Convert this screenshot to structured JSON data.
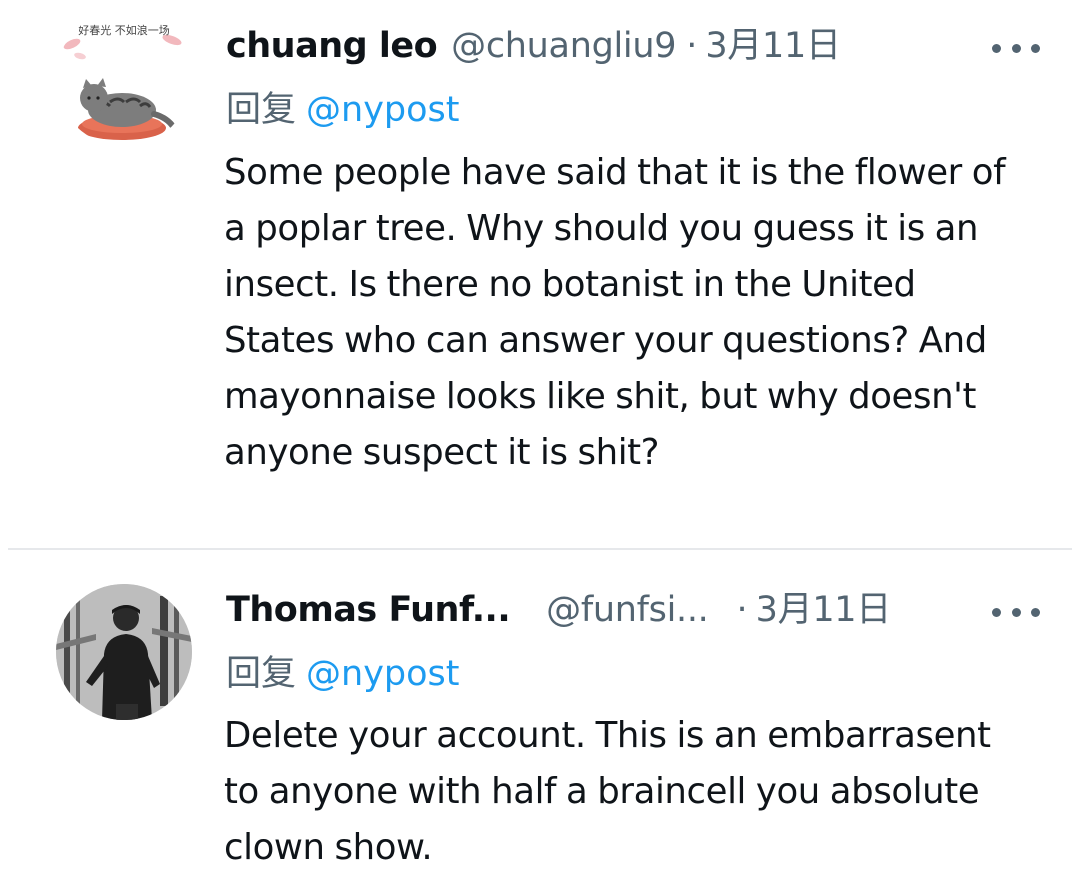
{
  "tweets": [
    {
      "display_name": "chuang leo",
      "handle": "@chuangliu9",
      "separator": "·",
      "date": "3月11日",
      "reply_prefix": "回复",
      "reply_to": "@nypost",
      "avatar_text": "好春光 不如浪一场",
      "text": "Some people have said that it is the flower of a poplar tree. Why should you guess it is an insect. Is there no botanist in the United States who can answer your questions? And mayonnaise looks like shit, but why doesn't anyone suspect it is shit?"
    },
    {
      "display_name": "Thomas Funf...",
      "handle": "@funfsi...",
      "separator": "·",
      "date": "3月11日",
      "reply_prefix": "回复",
      "reply_to": "@nypost",
      "text": "Delete your account. This is an embarrasent to anyone with half a braincell you absolute clown show."
    }
  ],
  "colors": {
    "primary_text": "#0f1419",
    "secondary_text": "#536471",
    "link": "#1d9bf0",
    "divider": "#e6e8eb"
  },
  "icons": {
    "more": "more-horizontal-icon"
  }
}
